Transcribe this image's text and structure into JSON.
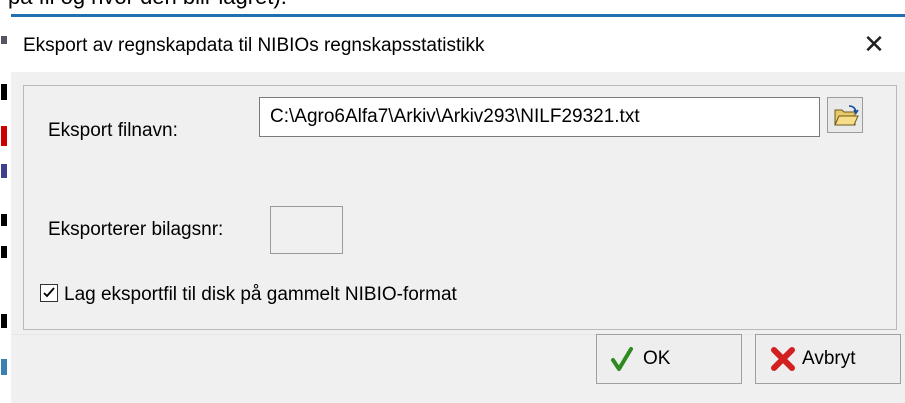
{
  "background_doc_text": "på fil og hvor den blir lagret).",
  "dialog": {
    "title": "Eksport av regnskapdata til NIBIOs regnskapsstatistikk",
    "close_glyph": "✕"
  },
  "export": {
    "filename_label": "Eksport filnavn:",
    "filename_value": "C:\\Agro6Alfa7\\Arkiv\\Arkiv293\\NILF29321.txt",
    "browse_icon": "folder-open-icon"
  },
  "bilag": {
    "label": "Eksporterer bilagsnr:",
    "value": ""
  },
  "old_format": {
    "label": "Lag eksportfil til disk på gammelt NIBIO-format",
    "checked": true
  },
  "buttons": {
    "ok_label": "OK",
    "cancel_label": "Avbryt"
  },
  "colors": {
    "accent_border": "#1f6fb2",
    "ok_check": "#2e8b1f",
    "cancel_x": "#d22020"
  }
}
